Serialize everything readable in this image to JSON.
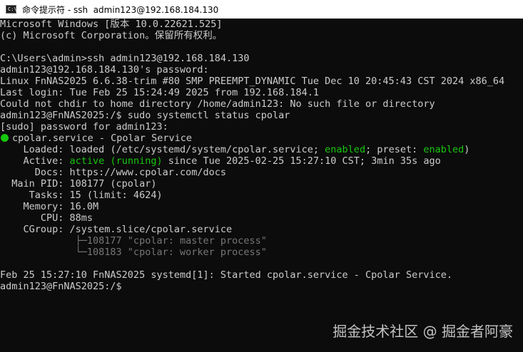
{
  "window": {
    "title": "命令提示符 - ssh  admin123@192.168.184.130",
    "icon": "cmd-prompt-icon"
  },
  "terminal": {
    "lines": [
      "Microsoft Windows [版本 10.0.22621.525]",
      "(c) Microsoft Corporation。保留所有权利。",
      "",
      "C:\\Users\\admin>ssh admin123@192.168.184.130",
      "admin123@192.168.184.130's password:",
      "Linux FnNAS2025 6.6.38-trim #80 SMP PREEMPT_DYNAMIC Tue Dec 10 20:45:43 CST 2024 x86_64",
      "Last login: Tue Feb 25 15:24:49 2025 from 192.168.184.1",
      "Could not chdir to home directory /home/admin123: No such file or directory",
      "admin123@FnNAS2025:/$ sudo systemctl status cpolar",
      "[sudo] password for admin123:"
    ],
    "service_line": "cpolar.service - Cpolar Service",
    "loaded": {
      "label": "    Loaded: ",
      "pre": "loaded (/etc/systemd/system/cpolar.service; ",
      "enabled1": "enabled",
      "mid": "; preset: ",
      "enabled2": "enabled",
      "post": ")"
    },
    "active": {
      "label": "    Active: ",
      "state": "active (running)",
      "post": " since Tue 2025-02-25 15:27:10 CST; 3min 35s ago"
    },
    "detail_lines": [
      "      Docs: https://www.cpolar.com/docs",
      "  Main PID: 108177 (cpolar)",
      "     Tasks: 15 (limit: 4624)",
      "    Memory: 16.0M",
      "       CPU: 88ms",
      "    CGroup: /system.slice/cpolar.service"
    ],
    "cgroup_tree": [
      "             ├─108177 \"cpolar: master process\"",
      "             └─108183 \"cpolar: worker process\""
    ],
    "footer_lines": [
      "",
      "Feb 25 15:27:10 FnNAS2025 systemd[1]: Started cpolar.service - Cpolar Service.",
      "admin123@FnNAS2025:/$"
    ]
  },
  "watermark": "掘金技术社区 @ 掘金者阿豪",
  "colors": {
    "background": "#0c0c0c",
    "text": "#cccccc",
    "green": "#16c60c",
    "tree": "#767676",
    "titlebar": "#ffffff"
  }
}
